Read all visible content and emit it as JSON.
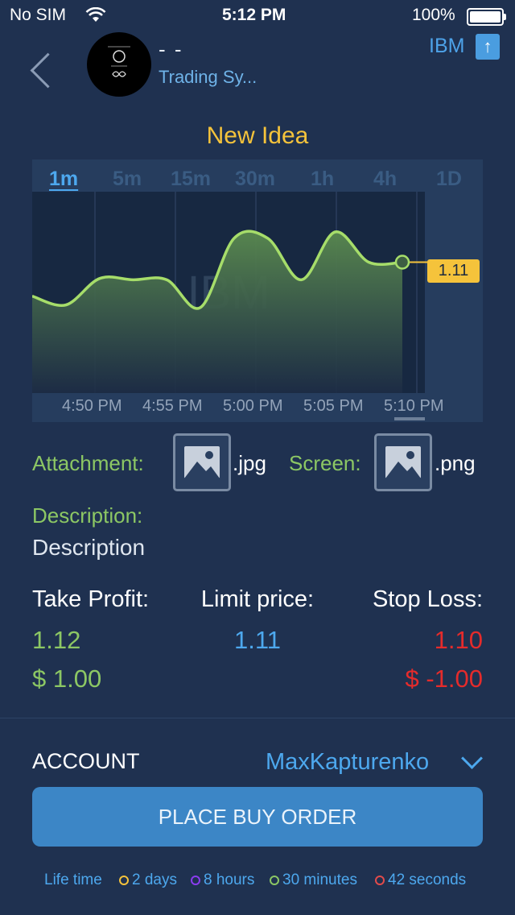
{
  "status_bar": {
    "carrier": "No SIM",
    "time": "5:12 PM",
    "battery": "100%"
  },
  "header": {
    "back_icon": "chevron-left-icon",
    "name": "- -",
    "subtitle": "Trading Sy...",
    "symbol": "IBM",
    "symbol_icon": "arrow-up-icon"
  },
  "title": "New Idea",
  "timeframes": [
    "1m",
    "5m",
    "15m",
    "30m",
    "1h",
    "4h",
    "1D"
  ],
  "active_timeframe": "1m",
  "chart_data": {
    "type": "area",
    "watermark": "IBM",
    "x_labels": [
      "4:50 PM",
      "4:55 PM",
      "5:00 PM",
      "5:05 PM",
      "5:10 PM"
    ],
    "current_price": "1.11",
    "series": [
      {
        "values": [
          0.985,
          0.95,
          1.055,
          1.05,
          1.05,
          0.94,
          1.215,
          1.215,
          1.05,
          1.24,
          1.12,
          1.12
        ]
      }
    ],
    "ylim": [
      0.6,
      1.4
    ],
    "line_color": "#a6dd6a",
    "fill_color": "#4f7a47"
  },
  "attachment": {
    "label": "Attachment:",
    "ext": ".jpg",
    "icon": "image-icon"
  },
  "screen": {
    "label": "Screen:",
    "ext": ".png",
    "icon": "image-icon"
  },
  "description": {
    "label": "Description:",
    "value": "Description"
  },
  "take_profit": {
    "label": "Take Profit:",
    "price": "1.12",
    "amount": "$ 1.00"
  },
  "limit_price": {
    "label": "Limit price:",
    "price": "1.11"
  },
  "stop_loss": {
    "label": "Stop Loss:",
    "price": "1.10",
    "amount": "$ -1.00"
  },
  "account": {
    "label": "ACCOUNT",
    "value": "MaxKapturenko",
    "icon": "chevron-down-icon"
  },
  "buy_button": "PLACE BUY ORDER",
  "lifetime": {
    "label": "Life time",
    "items": [
      {
        "text": "2 days",
        "color": "#f5c33b"
      },
      {
        "text": "8 hours",
        "color": "#8b3cf0"
      },
      {
        "text": "30 minutes",
        "color": "#8cc764"
      },
      {
        "text": "42 seconds",
        "color": "#e24b4b"
      }
    ]
  }
}
